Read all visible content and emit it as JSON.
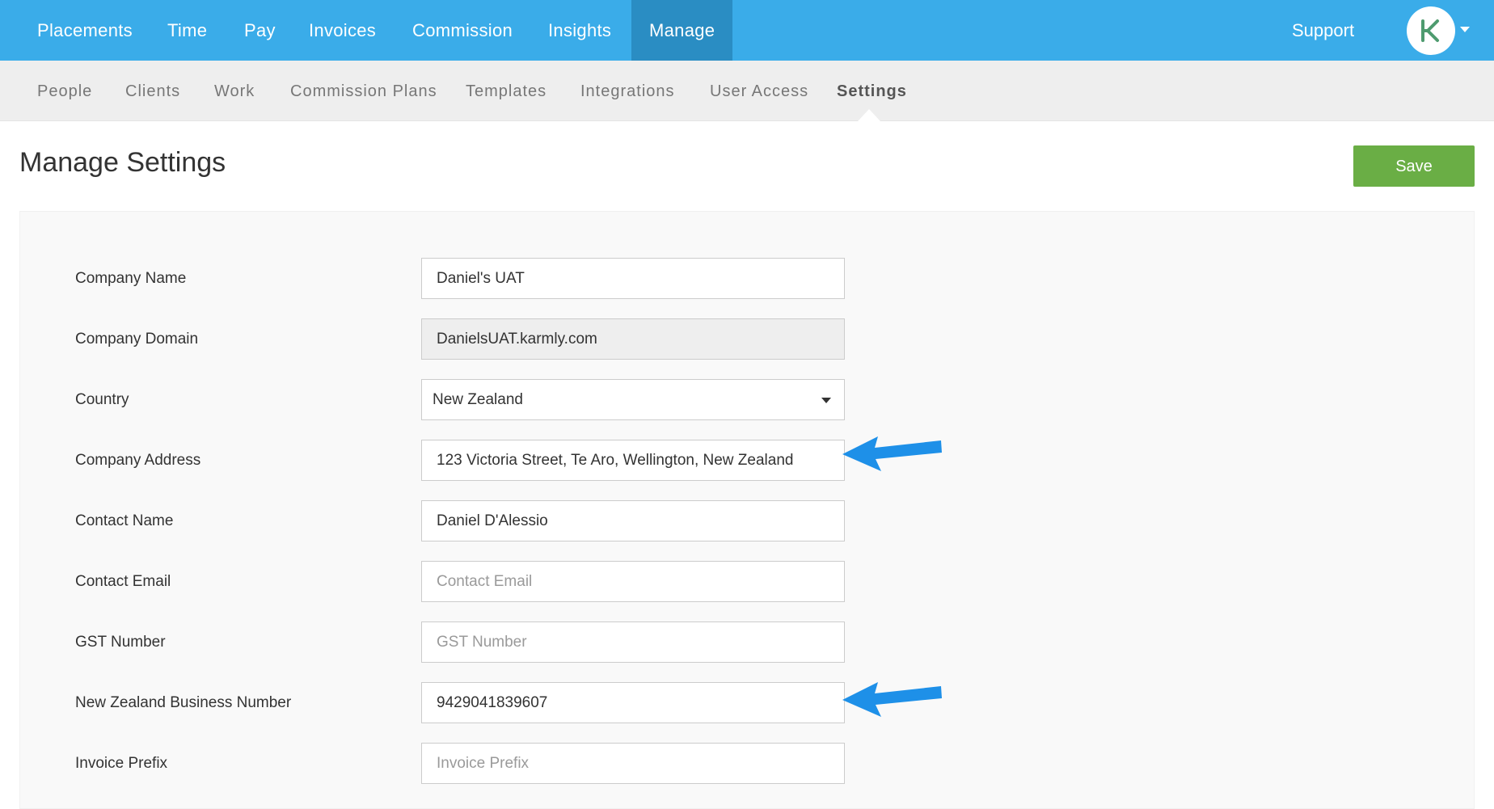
{
  "topnav": {
    "items": [
      {
        "label": "Placements"
      },
      {
        "label": "Time"
      },
      {
        "label": "Pay"
      },
      {
        "label": "Invoices"
      },
      {
        "label": "Commission"
      },
      {
        "label": "Insights"
      },
      {
        "label": "Manage",
        "active": true
      }
    ],
    "support_label": "Support",
    "avatar_icon": "karmly-logo-icon"
  },
  "subnav": {
    "items": [
      {
        "label": "People"
      },
      {
        "label": "Clients"
      },
      {
        "label": "Work"
      },
      {
        "label": "Commission Plans"
      },
      {
        "label": "Templates"
      },
      {
        "label": "Integrations"
      },
      {
        "label": "User Access"
      },
      {
        "label": "Settings",
        "active": true
      }
    ]
  },
  "page": {
    "title": "Manage Settings",
    "save_label": "Save"
  },
  "form": {
    "company_name": {
      "label": "Company Name",
      "value": "Daniel's UAT",
      "placeholder": "Company Name"
    },
    "company_domain": {
      "label": "Company Domain",
      "value": "DanielsUAT.karmly.com"
    },
    "country": {
      "label": "Country",
      "value": "New Zealand"
    },
    "company_address": {
      "label": "Company Address",
      "value": "123 Victoria Street, Te Aro, Wellington, New Zealand",
      "placeholder": "Company Address"
    },
    "contact_name": {
      "label": "Contact Name",
      "value": "Daniel D'Alessio",
      "placeholder": "Contact Name"
    },
    "contact_email": {
      "label": "Contact Email",
      "value": "",
      "placeholder": "Contact Email"
    },
    "gst_number": {
      "label": "GST Number",
      "value": "",
      "placeholder": "GST Number"
    },
    "nz_business_number": {
      "label": "New Zealand Business Number",
      "value": "9429041839607",
      "placeholder": "New Zealand Business Number"
    },
    "invoice_prefix": {
      "label": "Invoice Prefix",
      "value": "",
      "placeholder": "Invoice Prefix"
    }
  },
  "colors": {
    "topnav_bg": "#3aace9",
    "topnav_active": "#2a8dc3",
    "save_button": "#6aae45",
    "annotation_arrow": "#1e90e8"
  }
}
